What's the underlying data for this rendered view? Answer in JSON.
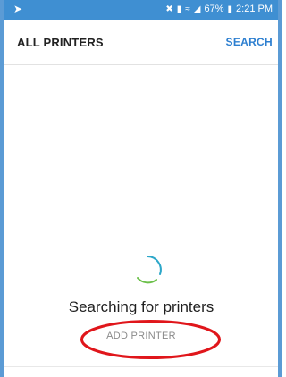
{
  "status_bar": {
    "left_icon": "location-arrow-icon",
    "icons": [
      "mute-icon",
      "vibrate-icon",
      "wifi-icon",
      "signal-icon"
    ],
    "battery": "67%",
    "battery_icon": "battery-icon",
    "time": "2:21 PM"
  },
  "app_bar": {
    "title": "ALL PRINTERS",
    "search_label": "SEARCH"
  },
  "main": {
    "status_text": "Searching for printers",
    "add_printer_label": "ADD PRINTER",
    "spinner_icon": "loading-spinner-icon"
  },
  "colors": {
    "status_bar": "#3f8fd2",
    "accent": "#2d7fd0",
    "spinner_a": "#2ca7c9",
    "spinner_b": "#6cc04a",
    "highlight": "#e0161b"
  }
}
